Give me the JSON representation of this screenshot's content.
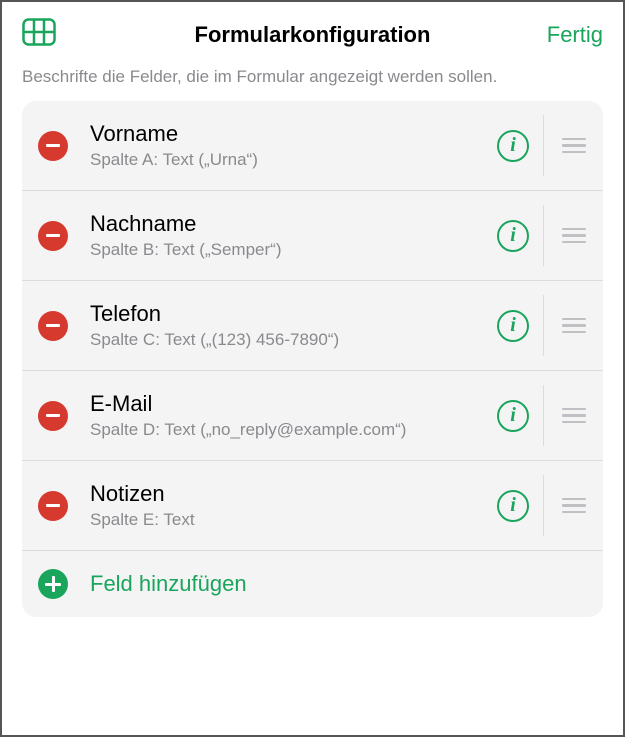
{
  "header": {
    "title": "Formularkonfiguration",
    "done_label": "Fertig"
  },
  "instructions": "Beschrifte die Felder, die im Formular angezeigt werden sollen.",
  "fields": [
    {
      "title": "Vorname",
      "subtitle": "Spalte A: Text („Urna“)"
    },
    {
      "title": "Nachname",
      "subtitle": "Spalte B: Text („Semper“)"
    },
    {
      "title": "Telefon",
      "subtitle": "Spalte C: Text („(123) 456-7890“)"
    },
    {
      "title": "E-Mail",
      "subtitle": "Spalte D: Text („no_reply@example.com“)"
    },
    {
      "title": "Notizen",
      "subtitle": "Spalte E: Text"
    }
  ],
  "add_field_label": "Feld hinzufügen",
  "colors": {
    "accent": "#1aa55d",
    "destructive": "#d63a2f"
  }
}
